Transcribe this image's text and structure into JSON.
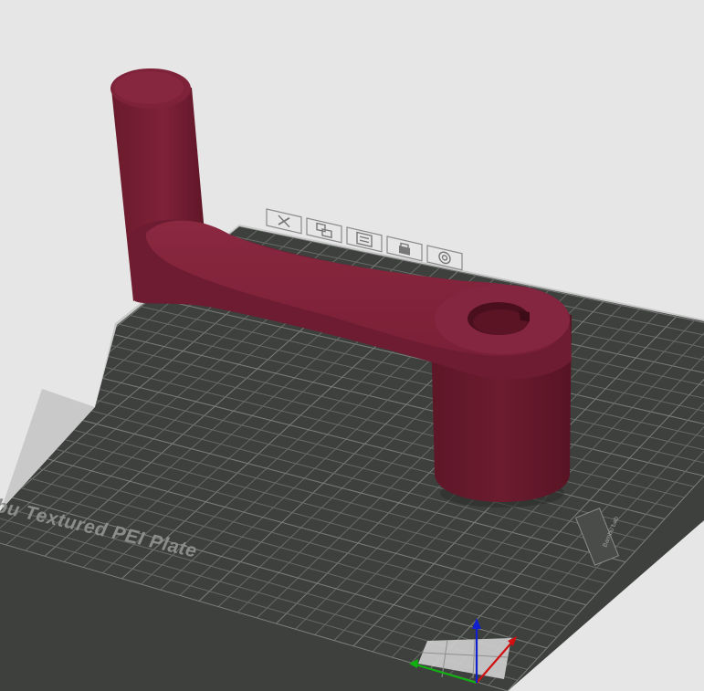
{
  "plate": {
    "label": "bu Textured PEI Plate",
    "side_label": "Bambu Lab"
  },
  "plate_toolbar": [
    {
      "id": "close",
      "icon": "close-icon"
    },
    {
      "id": "arrange",
      "icon": "arrange-icon"
    },
    {
      "id": "plate-settings",
      "icon": "plate-settings-icon"
    },
    {
      "id": "lock",
      "icon": "lock-icon"
    },
    {
      "id": "auto-orient",
      "icon": "orient-icon"
    }
  ],
  "model": {
    "name": "crank-handle",
    "color": "#7a1f35"
  },
  "colors": {
    "background": "#e6e6e6",
    "plate": "#3e403e",
    "grid": "#6b6e6b",
    "model": "#7a1f35",
    "axis_x": "#d01010",
    "axis_y": "#10b010",
    "axis_z": "#1020d0"
  }
}
